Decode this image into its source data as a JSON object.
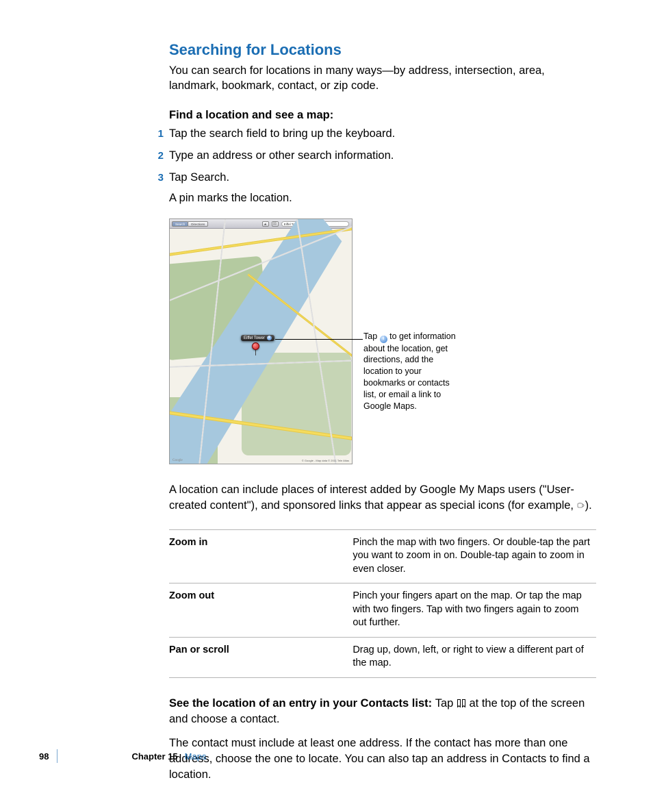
{
  "heading": "Searching for Locations",
  "intro": "You can search for locations in many ways—by address, intersection, area, landmark, bookmark, contact, or zip code.",
  "task_heading": "Find a location and see a map:",
  "steps": {
    "n1": "1",
    "t1": "Tap the search field to bring up the keyboard.",
    "n2": "2",
    "t2": "Type an address or other search information.",
    "n3": "3",
    "t3": "Tap Search."
  },
  "after_list": "A pin marks the location.",
  "map": {
    "seg_search": "Search",
    "seg_directions": "Directions",
    "search_value": "Eiffel Tower",
    "pin_label": "Eiffel Tower",
    "attribution": "© Google - Map data © 2011 Tele Atlas",
    "logo": "Google"
  },
  "callout": {
    "line1a": "Tap ",
    "line1b": " to get information about the location, get directions, add the location to your bookmarks or contacts list, or email a link to Google Maps."
  },
  "para_after_fig_a": "A location can include places of interest added by Google My Maps users (\"User-created content\"), and sponsored links that appear as special icons (for example, ",
  "para_after_fig_b": ").",
  "table": {
    "r1l": "Zoom in",
    "r1d": "Pinch the map with two fingers. Or double-tap the part you want to zoom in on. Double-tap again to zoom in even closer.",
    "r2l": "Zoom out",
    "r2d": "Pinch your fingers apart on the map. Or tap the map with two fingers. Tap with two fingers again to zoom out further.",
    "r3l": "Pan or scroll",
    "r3d": "Drag up, down, left, or right to view a different part of the map."
  },
  "contacts_task": {
    "bold": "See the location of an entry in your Contacts list:  ",
    "a": "Tap ",
    "b": " at the top of the screen and choose a contact."
  },
  "contacts_note": "The contact must include at least one address. If the contact has more than one address, choose the one to locate. You can also tap an address in Contacts to find a location.",
  "footer": {
    "page": "98",
    "chapter_label": "Chapter 15",
    "chapter_name": "Maps"
  }
}
